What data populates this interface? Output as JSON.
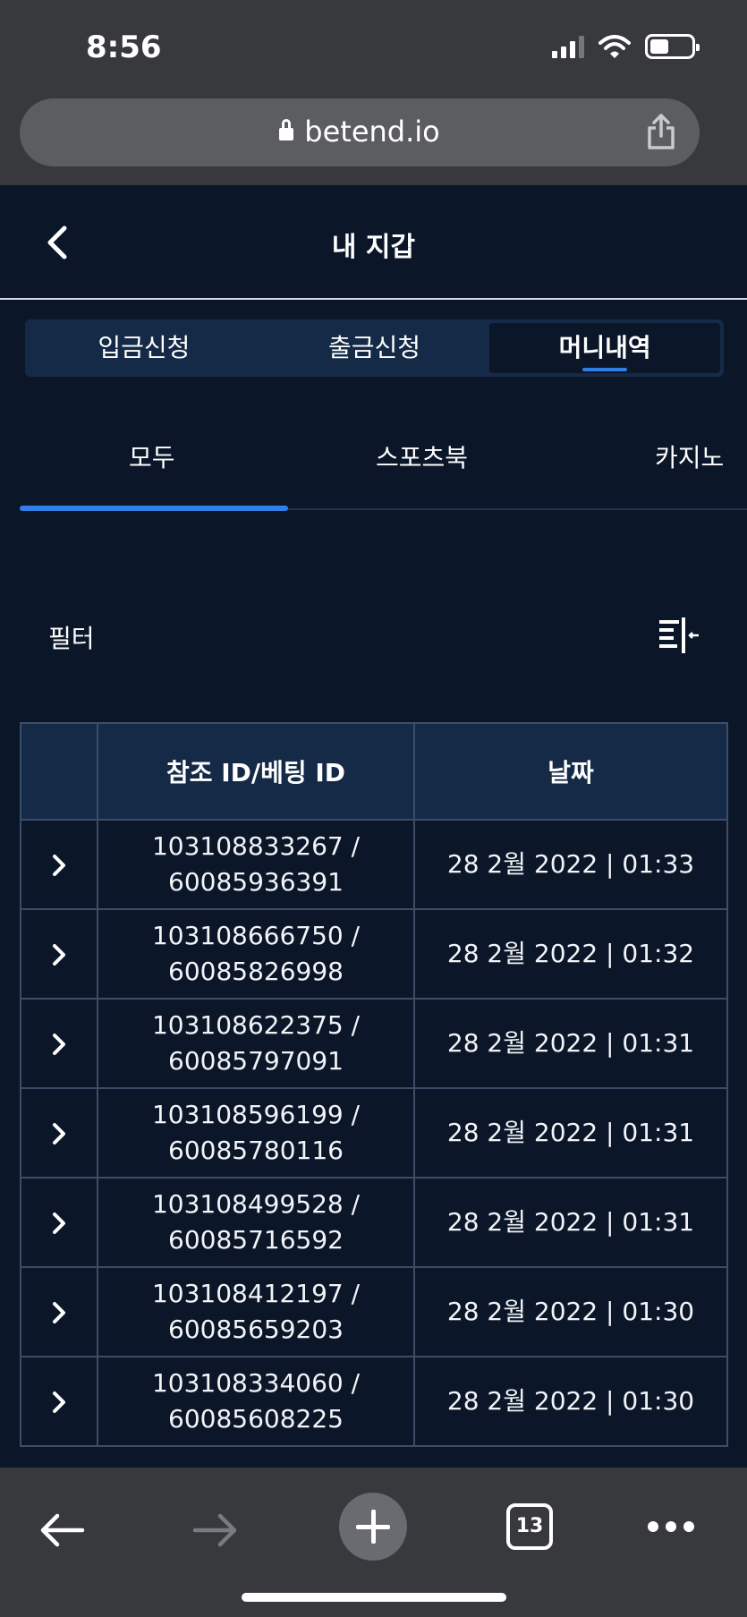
{
  "status_bar": {
    "time": "8:56"
  },
  "browser": {
    "url": "betend.io",
    "tabs_count": "13"
  },
  "header": {
    "title": "내 지갑"
  },
  "segment_tabs": [
    {
      "label": "입금신청",
      "active": false
    },
    {
      "label": "출금신청",
      "active": false
    },
    {
      "label": "머니내역",
      "active": true
    }
  ],
  "sub_tabs": [
    {
      "label": "모두",
      "active": true
    },
    {
      "label": "스포츠북",
      "active": false
    },
    {
      "label": "카지노",
      "active": false
    }
  ],
  "filter": {
    "label": "필터"
  },
  "table": {
    "headers": [
      "참조 ID/베팅 ID",
      "날짜"
    ],
    "rows": [
      {
        "ref_id": "103108833267 /",
        "bet_id": "60085936391",
        "date": "28 2월 2022 | 01:33"
      },
      {
        "ref_id": "103108666750 /",
        "bet_id": "60085826998",
        "date": "28 2월 2022 | 01:32"
      },
      {
        "ref_id": "103108622375 /",
        "bet_id": "60085797091",
        "date": "28 2월 2022 | 01:31"
      },
      {
        "ref_id": "103108596199 /",
        "bet_id": "60085780116",
        "date": "28 2월 2022 | 01:31"
      },
      {
        "ref_id": "103108499528 /",
        "bet_id": "60085716592",
        "date": "28 2월 2022 | 01:31"
      },
      {
        "ref_id": "103108412197 /",
        "bet_id": "60085659203",
        "date": "28 2월 2022 | 01:30"
      },
      {
        "ref_id": "103108334060 /",
        "bet_id": "60085608225",
        "date": "28 2월 2022 | 01:30"
      }
    ]
  },
  "colors": {
    "background": "#0b1628",
    "accent": "#2f7fe6",
    "header_bg": "#142a47",
    "chrome": "#38393d"
  }
}
